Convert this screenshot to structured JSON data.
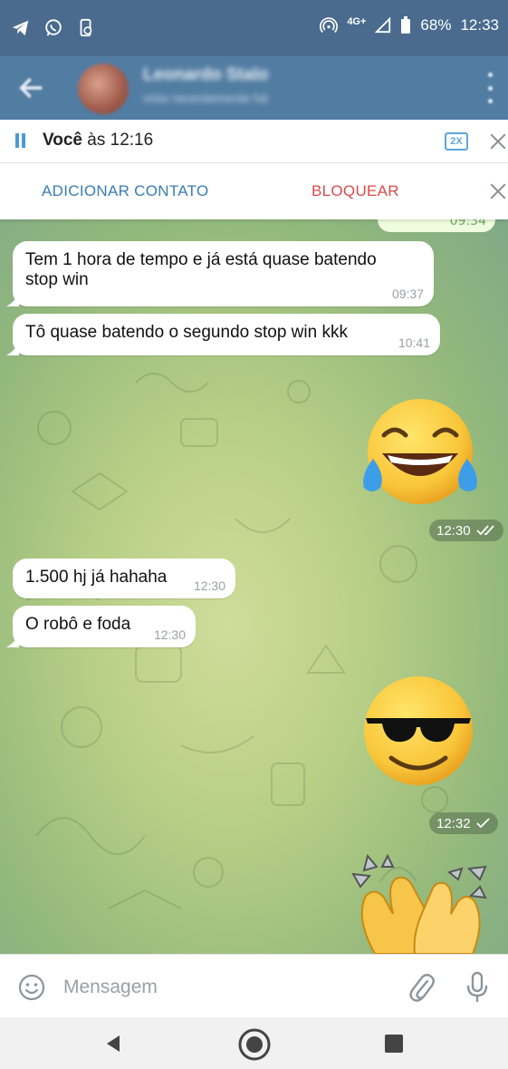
{
  "status_bar": {
    "network": "4G+",
    "battery": "68%",
    "time": "12:33",
    "left_icons": [
      "telegram-icon",
      "whatsapp-icon",
      "phone-sync-icon"
    ],
    "right_icons": [
      "hotspot-icon",
      "signal-icon",
      "battery-icon"
    ]
  },
  "header": {
    "contact_name": "Leonardo Stalo",
    "contact_status": "visto recentemente há"
  },
  "player": {
    "sender": "Você",
    "time_text": "às 12:16",
    "speed": "2X"
  },
  "contact_bar": {
    "add_label": "ADICIONAR CONTATO",
    "block_label": "BLOQUEAR"
  },
  "messages": [
    {
      "type": "partial-outgoing",
      "time": "09:34"
    },
    {
      "type": "incoming",
      "text_line1": "Tem 1 hora de tempo e já está quase batendo",
      "text_line2": "stop win",
      "time": "09:37"
    },
    {
      "type": "incoming",
      "text": "Tô quase batendo o segundo stop win kkk",
      "time": "10:41"
    },
    {
      "type": "outgoing-emoji",
      "emoji": "tears-of-joy",
      "time": "12:30",
      "status": "read"
    },
    {
      "type": "incoming",
      "text": "1.500 hj já hahaha",
      "time": "12:30"
    },
    {
      "type": "incoming",
      "text": "O robô e foda",
      "time": "12:30"
    },
    {
      "type": "outgoing-emoji",
      "emoji": "sunglasses",
      "time": "12:32",
      "status": "sent"
    },
    {
      "type": "outgoing-emoji",
      "emoji": "clapping-hands"
    }
  ],
  "composer": {
    "placeholder": "Mensagem"
  },
  "colors": {
    "status_bar": "#4a6b8e",
    "app_bar": "#527da3",
    "accent_blue": "#3a7cb4",
    "danger_red": "#d84a4a"
  }
}
